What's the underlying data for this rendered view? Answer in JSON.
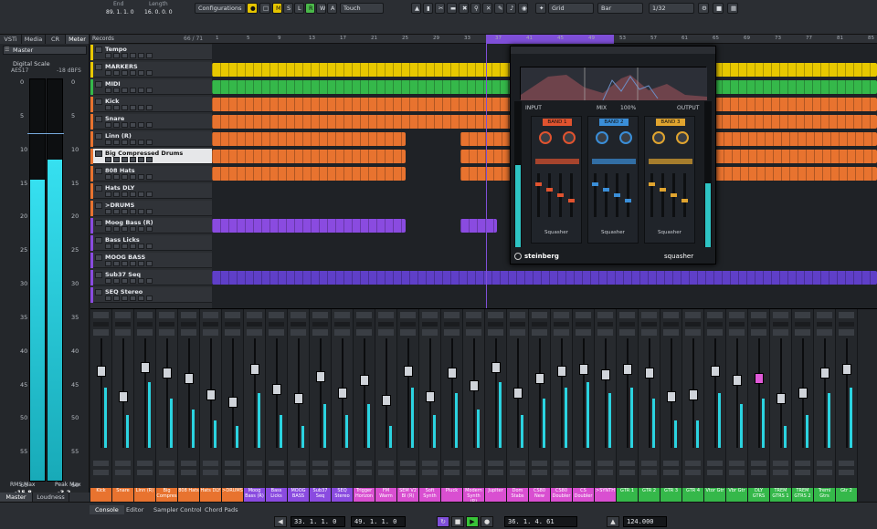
{
  "toolbar": {
    "end_label": "End",
    "length_label": "Length",
    "end_value": "89. 1. 1. 0",
    "length_value": "16. 0. 0. 0",
    "configurations": "Configurations",
    "mode_m": "M",
    "mode_s": "S",
    "mode_l": "L",
    "mode_r": "R",
    "mode_w": "W",
    "mode_a": "A",
    "automation_mode": "Touch",
    "grid_type": "Grid",
    "grid_value": "Bar",
    "quantize": "1/32"
  },
  "left_tabs": [
    "VSTi",
    "Media",
    "CR",
    "Meter"
  ],
  "meter": {
    "master_label": "Master",
    "digital_scale": "Digital Scale",
    "ref_level": "AES17",
    "ref_value": "-18 dBFS",
    "scale_left": [
      "0",
      "5",
      "10",
      "15",
      "20",
      "25",
      "30",
      "35",
      "40",
      "45",
      "50",
      "55",
      "60"
    ],
    "scale_right": [
      "0",
      "5",
      "10",
      "15",
      "20",
      "25",
      "30",
      "35",
      "40",
      "45",
      "50",
      "55",
      "60"
    ],
    "rms_label": "RMS Max",
    "peak_label": "Peak Max",
    "rms_value": "-15.8",
    "peak_value": "-3.2",
    "left_level": 0.75,
    "right_level": 0.8,
    "tabs": [
      "Master",
      "Loudness"
    ]
  },
  "tracklist": {
    "header": "Records",
    "counter": "66 / 71",
    "tracks": [
      {
        "name": "Tempo"
      },
      {
        "name": "MARKERS"
      },
      {
        "name": "MIDI"
      },
      {
        "name": "Kick"
      },
      {
        "name": "Snare"
      },
      {
        "name": "Linn (R)"
      },
      {
        "name": "Big Compressed Drums"
      },
      {
        "name": "808 Hats"
      },
      {
        "name": "Hats DLY"
      },
      {
        "name": ">DRUMS"
      },
      {
        "name": "Moog Bass (R)"
      },
      {
        "name": "Bass Licks"
      },
      {
        "name": "MOOG BASS"
      },
      {
        "name": "Sub37 Seq"
      },
      {
        "name": "SEQ Stereo"
      }
    ]
  },
  "ruler": [
    "1",
    "5",
    "9",
    "13",
    "17",
    "21",
    "25",
    "29",
    "33",
    "37",
    "41",
    "45",
    "49",
    "53",
    "57",
    "61",
    "65",
    "69",
    "73",
    "77",
    "81",
    "85"
  ],
  "plugin": {
    "title": "squasher",
    "brand": "steinberg",
    "bands": [
      "BAND 1",
      "BAND 2",
      "BAND 3"
    ],
    "sections": [
      "INPUT",
      "OUTPUT",
      "MIX"
    ],
    "squasher_label": "Squasher",
    "mix_value": "100%"
  },
  "mixer": {
    "channels": [
      {
        "name": "Kick",
        "color": "#e8732f"
      },
      {
        "name": "Snare",
        "color": "#e8732f"
      },
      {
        "name": "Linn (R)",
        "color": "#e8732f"
      },
      {
        "name": "Big Compres",
        "color": "#e8732f"
      },
      {
        "name": "808 Hats",
        "color": "#e8732f"
      },
      {
        "name": "Hats DLY",
        "color": "#e8732f"
      },
      {
        "name": ">DRUMS",
        "color": "#e8732f"
      },
      {
        "name": "Moog Bass (R)",
        "color": "#8a4be0"
      },
      {
        "name": "Bass Licks",
        "color": "#8a4be0"
      },
      {
        "name": "MOOG BASS",
        "color": "#8a4be0"
      },
      {
        "name": "Sub37 Seq",
        "color": "#8a4be0"
      },
      {
        "name": "SEQ Stereo",
        "color": "#8a4be0"
      },
      {
        "name": "Trigger Horizon",
        "color": "#d94fd1"
      },
      {
        "name": "FM Warm",
        "color": "#d94fd1"
      },
      {
        "name": "SEM V2 Bl (R)",
        "color": "#d94fd1"
      },
      {
        "name": "Soft Synth",
        "color": "#d94fd1"
      },
      {
        "name": "Pluck",
        "color": "#d94fd1"
      },
      {
        "name": "Modern Synth (R)",
        "color": "#d94fd1"
      },
      {
        "name": "Jupiter",
        "color": "#d94fd1"
      },
      {
        "name": "Dom Stabs",
        "color": "#d94fd1"
      },
      {
        "name": "CS80 New",
        "color": "#d94fd1"
      },
      {
        "name": "CS80 Doubler",
        "color": "#d94fd1"
      },
      {
        "name": "CS Doubler",
        "color": "#d94fd1"
      },
      {
        "name": ">SYNTH",
        "color": "#d94fd1"
      },
      {
        "name": "GTR 1",
        "color": "#35b84a"
      },
      {
        "name": "GTR 2",
        "color": "#35b84a"
      },
      {
        "name": "GTR 3",
        "color": "#35b84a"
      },
      {
        "name": "GTR 4",
        "color": "#35b84a"
      },
      {
        "name": "Vtor Gtr",
        "color": "#35b84a"
      },
      {
        "name": "Vbr Gtr",
        "color": "#35b84a"
      },
      {
        "name": "DLY GTRS",
        "color": "#35b84a"
      },
      {
        "name": "TREM GTRS 1",
        "color": "#35b84a"
      },
      {
        "name": "TREM GTRS 2",
        "color": "#35b84a"
      },
      {
        "name": "Tremi Gtrs",
        "color": "#35b84a"
      },
      {
        "name": "Gtr 2",
        "color": "#35b84a"
      },
      {
        "name": "Out L",
        "color": "#35b84a"
      }
    ]
  },
  "bottom_tabs": [
    "Console",
    "Editor",
    "Sampler Control",
    "Chord Pads"
  ],
  "transport": {
    "left_locator": "33. 1. 1. 0",
    "right_locator": "49. 1. 1. 0",
    "position": "36. 1. 4. 61",
    "tempo": "124.000"
  }
}
